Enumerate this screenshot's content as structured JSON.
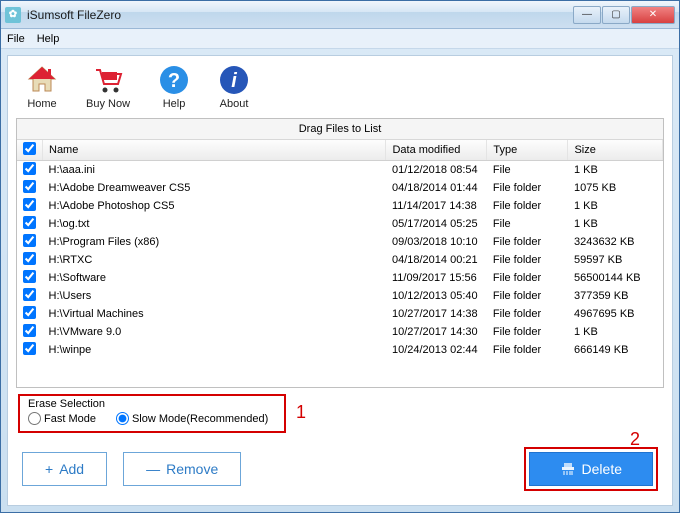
{
  "window": {
    "title": "iSumsoft FileZero"
  },
  "menus": {
    "file": "File",
    "help": "Help"
  },
  "toolbar": {
    "home": "Home",
    "buy": "Buy Now",
    "help": "Help",
    "about": "About"
  },
  "panel": {
    "drag_hint": "Drag Files to List",
    "cols": {
      "name": "Name",
      "date": "Data modified",
      "type": "Type",
      "size": "Size"
    },
    "rows": [
      {
        "name": "H:\\aaa.ini",
        "date": "01/12/2018 08:54",
        "type": "File",
        "size": "1 KB"
      },
      {
        "name": "H:\\Adobe Dreamweaver CS5",
        "date": "04/18/2014 01:44",
        "type": "File folder",
        "size": "1075 KB"
      },
      {
        "name": "H:\\Adobe Photoshop CS5",
        "date": "11/14/2017 14:38",
        "type": "File folder",
        "size": "1 KB"
      },
      {
        "name": "H:\\og.txt",
        "date": "05/17/2014 05:25",
        "type": "File",
        "size": "1 KB"
      },
      {
        "name": "H:\\Program Files (x86)",
        "date": "09/03/2018 10:10",
        "type": "File folder",
        "size": "3243632 KB"
      },
      {
        "name": "H:\\RTXC",
        "date": "04/18/2014 00:21",
        "type": "File folder",
        "size": "59597 KB"
      },
      {
        "name": "H:\\Software",
        "date": "11/09/2017 15:56",
        "type": "File folder",
        "size": "56500144 KB"
      },
      {
        "name": "H:\\Users",
        "date": "10/12/2013 05:40",
        "type": "File folder",
        "size": "377359 KB"
      },
      {
        "name": "H:\\Virtual Machines",
        "date": "10/27/2017 14:38",
        "type": "File folder",
        "size": "4967695 KB"
      },
      {
        "name": "H:\\VMware 9.0",
        "date": "10/27/2017 14:30",
        "type": "File folder",
        "size": "1 KB"
      },
      {
        "name": "H:\\winpe",
        "date": "10/24/2013 02:44",
        "type": "File folder",
        "size": "666149 KB"
      }
    ]
  },
  "erase": {
    "legend": "Erase Selection",
    "fast": "Fast Mode",
    "slow": "Slow Mode(Recommended)"
  },
  "callouts": {
    "one": "1",
    "two": "2"
  },
  "buttons": {
    "add": "Add",
    "remove": "Remove",
    "delete": "Delete"
  }
}
